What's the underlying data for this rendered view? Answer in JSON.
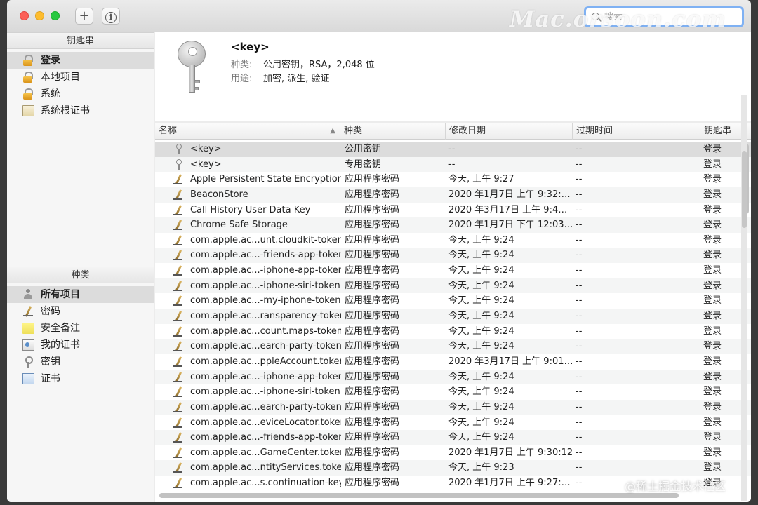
{
  "titlebar": {
    "add_label": "+",
    "info_label": "i",
    "watermark": "Mac.orsoon.com",
    "search_placeholder": "搜索"
  },
  "sidebar": {
    "keychains_header": "钥匙串",
    "keychains": [
      {
        "label": "登录",
        "icon": "lock-open-icon",
        "selected": true
      },
      {
        "label": "本地项目",
        "icon": "lock-open-icon",
        "selected": false
      },
      {
        "label": "系统",
        "icon": "lock-icon",
        "selected": false
      },
      {
        "label": "系统根证书",
        "icon": "certificate-cabinet-icon",
        "selected": false
      }
    ],
    "category_header": "种类",
    "categories": [
      {
        "label": "所有项目",
        "icon": "all-items-icon",
        "selected": true
      },
      {
        "label": "密码",
        "icon": "password-pencil-icon",
        "selected": false
      },
      {
        "label": "安全备注",
        "icon": "secure-note-icon",
        "selected": false
      },
      {
        "label": "我的证书",
        "icon": "my-certificate-icon",
        "selected": false
      },
      {
        "label": "密钥",
        "icon": "key-icon",
        "selected": false
      },
      {
        "label": "证书",
        "icon": "certificate-icon",
        "selected": false
      }
    ]
  },
  "detail": {
    "title": "<key>",
    "kind_label": "种类:",
    "kind_value": "公用密钥，RSA，2,048 位",
    "usage_label": "用途:",
    "usage_value": "加密, 派生, 验证"
  },
  "table": {
    "columns": [
      "名称",
      "种类",
      "修改日期",
      "过期时间",
      "钥匙串"
    ],
    "rows": [
      {
        "icon": "key",
        "name": "<key>",
        "kind": "公用密钥",
        "date": "--",
        "expires": "--",
        "keychain": "登录"
      },
      {
        "icon": "key",
        "name": "<key>",
        "kind": "专用密钥",
        "date": "--",
        "expires": "--",
        "keychain": "登录"
      },
      {
        "icon": "pencil",
        "name": "Apple Persistent State Encryption",
        "kind": "应用程序密码",
        "date": "今天, 上午 9:27",
        "expires": "--",
        "keychain": "登录"
      },
      {
        "icon": "pencil",
        "name": "BeaconStore",
        "kind": "应用程序密码",
        "date": "2020 年1月7日 上午 9:32:…",
        "expires": "--",
        "keychain": "登录"
      },
      {
        "icon": "pencil",
        "name": "Call History User Data Key",
        "kind": "应用程序密码",
        "date": "2020 年3月17日 上午 9:4…",
        "expires": "--",
        "keychain": "登录"
      },
      {
        "icon": "pencil",
        "name": "Chrome Safe Storage",
        "kind": "应用程序密码",
        "date": "2020 年1月7日 下午 12:03…",
        "expires": "--",
        "keychain": "登录"
      },
      {
        "icon": "pencil",
        "name": "com.apple.ac...unt.cloudkit-token",
        "kind": "应用程序密码",
        "date": "今天, 上午 9:24",
        "expires": "--",
        "keychain": "登录"
      },
      {
        "icon": "pencil",
        "name": "com.apple.ac...-friends-app-token",
        "kind": "应用程序密码",
        "date": "今天, 上午 9:24",
        "expires": "--",
        "keychain": "登录"
      },
      {
        "icon": "pencil",
        "name": "com.apple.ac...-iphone-app-token",
        "kind": "应用程序密码",
        "date": "今天, 上午 9:24",
        "expires": "--",
        "keychain": "登录"
      },
      {
        "icon": "pencil",
        "name": "com.apple.ac...-iphone-siri-token",
        "kind": "应用程序密码",
        "date": "今天, 上午 9:24",
        "expires": "--",
        "keychain": "登录"
      },
      {
        "icon": "pencil",
        "name": "com.apple.ac...-my-iphone-token",
        "kind": "应用程序密码",
        "date": "今天, 上午 9:24",
        "expires": "--",
        "keychain": "登录"
      },
      {
        "icon": "pencil",
        "name": "com.apple.ac...ransparency-token",
        "kind": "应用程序密码",
        "date": "今天, 上午 9:24",
        "expires": "--",
        "keychain": "登录"
      },
      {
        "icon": "pencil",
        "name": "com.apple.ac...count.maps-token",
        "kind": "应用程序密码",
        "date": "今天, 上午 9:24",
        "expires": "--",
        "keychain": "登录"
      },
      {
        "icon": "pencil",
        "name": "com.apple.ac...earch-party-token",
        "kind": "应用程序密码",
        "date": "今天, 上午 9:24",
        "expires": "--",
        "keychain": "登录"
      },
      {
        "icon": "pencil",
        "name": "com.apple.ac...ppleAccount.token",
        "kind": "应用程序密码",
        "date": "2020 年3月17日 上午 9:01…",
        "expires": "--",
        "keychain": "登录"
      },
      {
        "icon": "pencil",
        "name": "com.apple.ac...-iphone-app-token",
        "kind": "应用程序密码",
        "date": "今天, 上午 9:24",
        "expires": "--",
        "keychain": "登录"
      },
      {
        "icon": "pencil",
        "name": "com.apple.ac...-iphone-siri-token",
        "kind": "应用程序密码",
        "date": "今天, 上午 9:24",
        "expires": "--",
        "keychain": "登录"
      },
      {
        "icon": "pencil",
        "name": "com.apple.ac...earch-party-token",
        "kind": "应用程序密码",
        "date": "今天, 上午 9:24",
        "expires": "--",
        "keychain": "登录"
      },
      {
        "icon": "pencil",
        "name": "com.apple.ac...eviceLocator.token",
        "kind": "应用程序密码",
        "date": "今天, 上午 9:24",
        "expires": "--",
        "keychain": "登录"
      },
      {
        "icon": "pencil",
        "name": "com.apple.ac...-friends-app-token",
        "kind": "应用程序密码",
        "date": "今天, 上午 9:24",
        "expires": "--",
        "keychain": "登录"
      },
      {
        "icon": "pencil",
        "name": "com.apple.ac...GameCenter.token",
        "kind": "应用程序密码",
        "date": "2020 年1月7日 上午 9:30:12",
        "expires": "--",
        "keychain": "登录"
      },
      {
        "icon": "pencil",
        "name": "com.apple.ac...ntityServices.token",
        "kind": "应用程序密码",
        "date": "今天, 上午 9:23",
        "expires": "--",
        "keychain": "登录"
      },
      {
        "icon": "pencil",
        "name": "com.apple.ac...s.continuation-key",
        "kind": "应用程序密码",
        "date": "2020 年1月7日 上午 9:27:…",
        "expires": "--",
        "keychain": "登录"
      }
    ]
  },
  "watermark_bottom": "@稀土掘金技术社区"
}
